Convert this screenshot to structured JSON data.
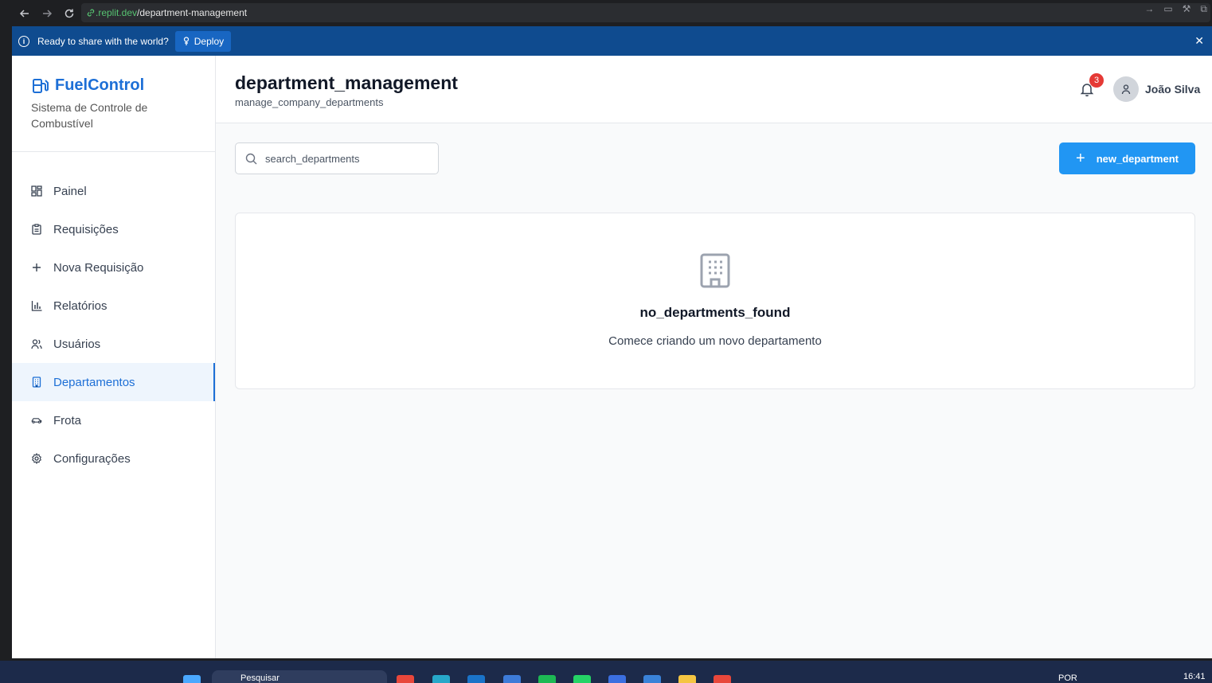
{
  "browser": {
    "url_domain": ".replit.dev",
    "url_path": "/department-management"
  },
  "deploy_bar": {
    "message": "Ready to share with the world?",
    "button_label": "Deploy"
  },
  "brand": {
    "title": "FuelControl",
    "subtitle": "Sistema de Controle de Combustível",
    "accent_color": "#1d6fd6"
  },
  "sidebar": {
    "items": [
      {
        "label": "Painel",
        "icon": "dashboard-grid-icon"
      },
      {
        "label": "Requisições",
        "icon": "clipboard-icon"
      },
      {
        "label": "Nova Requisição",
        "icon": "plus-icon"
      },
      {
        "label": "Relatórios",
        "icon": "bar-chart-icon"
      },
      {
        "label": "Usuários",
        "icon": "users-icon"
      },
      {
        "label": "Departamentos",
        "icon": "building-icon",
        "active": true
      },
      {
        "label": "Frota",
        "icon": "car-icon"
      },
      {
        "label": "Configurações",
        "icon": "gear-icon"
      }
    ]
  },
  "header": {
    "title": "department_management",
    "subtitle": "manage_company_departments",
    "notification_count": "3",
    "user_name": "João Silva"
  },
  "toolbar": {
    "search_placeholder": "search_departments",
    "new_button_label": "new_department",
    "button_color": "#2196f3"
  },
  "empty_state": {
    "title": "no_departments_found",
    "description": "Comece criando um novo departamento",
    "icon": "building-icon"
  },
  "taskbar": {
    "search_text": "Pesquisar",
    "language": "POR",
    "time": "16:41"
  }
}
